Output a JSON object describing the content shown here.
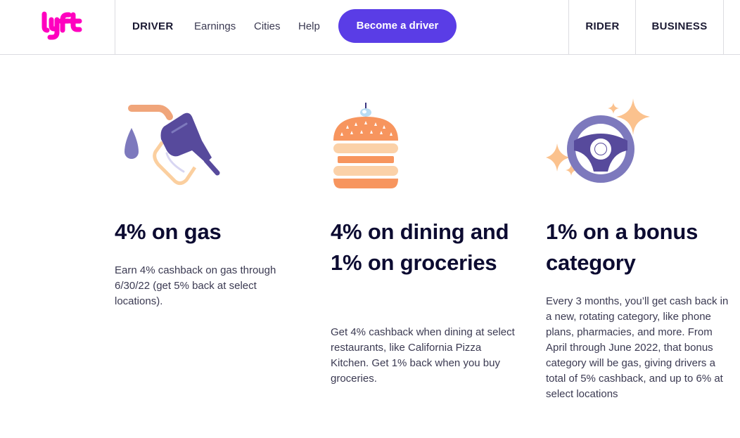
{
  "header": {
    "logo_text": "lyft",
    "nav": {
      "driver": "DRIVER",
      "earnings": "Earnings",
      "cities": "Cities",
      "help": "Help"
    },
    "cta_label": "Become a driver",
    "rider": "RIDER",
    "business": "BUSINESS"
  },
  "features": [
    {
      "icon": "gas-pump-icon",
      "title": "4% on gas",
      "body": "Earn 4% cashback on gas through 6/30/22 (get 5% back at select locations)."
    },
    {
      "icon": "burger-icon",
      "title": "4% on dining and 1% on groceries",
      "body": "Get 4% cashback when dining at select restaurants, like California Pizza Kitchen. Get 1% back when you buy groceries."
    },
    {
      "icon": "steering-wheel-icon",
      "title": "1% on a bonus category",
      "body": "Every 3 months, you’ll get cash back in a new, rotating category, like phone plans, pharmacies, and more. From April through June 2022, that bonus category will be gas, giving drivers a total of 5% cashback, and up to 6% at select locations"
    }
  ],
  "colors": {
    "brand_pink": "#ff00bf",
    "cta_purple": "#5a3de6",
    "text_dark": "#0c0b31",
    "icon_purple": "#5a4fa8",
    "icon_orange": "#f7955e",
    "icon_peach": "#fbd1a8"
  }
}
